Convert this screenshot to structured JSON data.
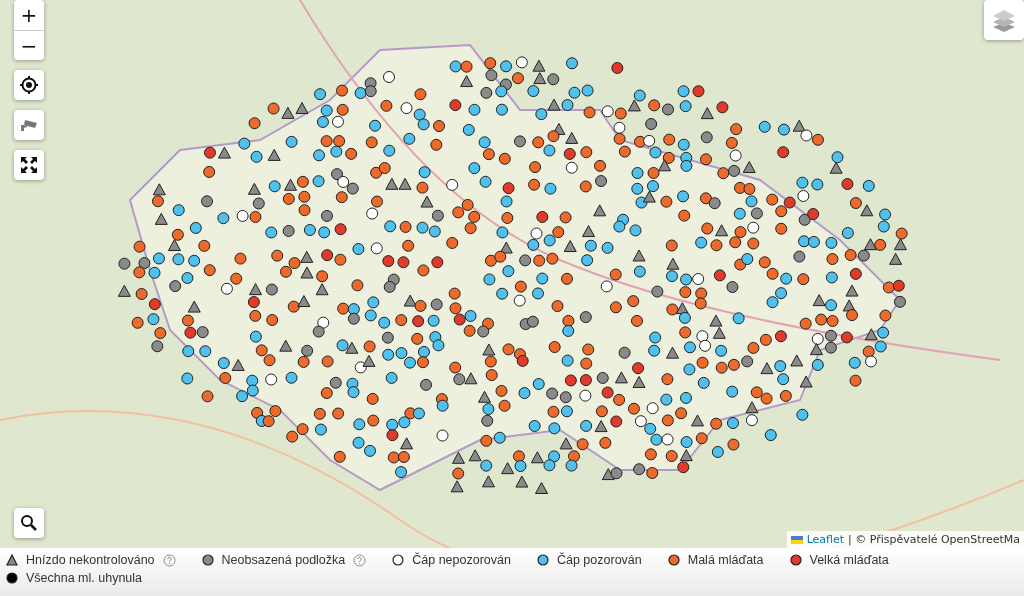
{
  "map": {
    "zoom_in": "+",
    "zoom_out": "−",
    "attribution": {
      "link": "Leaflet",
      "text": "| © Přispěvatelé OpenStreetMa"
    }
  },
  "legend": [
    {
      "kind": "triangle",
      "color": "#8a8a8a",
      "label": "Hnízdo nekontrolováno",
      "help": true
    },
    {
      "kind": "circle",
      "color": "#8a8a8a",
      "label": "Neobsazená podložka",
      "help": true
    },
    {
      "kind": "circle",
      "color": "#ffffff",
      "label": "Čáp nepozorován",
      "help": false
    },
    {
      "kind": "circle",
      "color": "#4fc1ef",
      "label": "Čáp pozorován",
      "help": false
    },
    {
      "kind": "circle",
      "color": "#ee6a2a",
      "label": "Malá mláďata",
      "help": false
    },
    {
      "kind": "circle",
      "color": "#e23a2a",
      "label": "Velká mláďata",
      "help": false
    },
    {
      "kind": "circle",
      "color": "#000000",
      "label": "Všechna ml. uhynula",
      "help": false
    }
  ]
}
